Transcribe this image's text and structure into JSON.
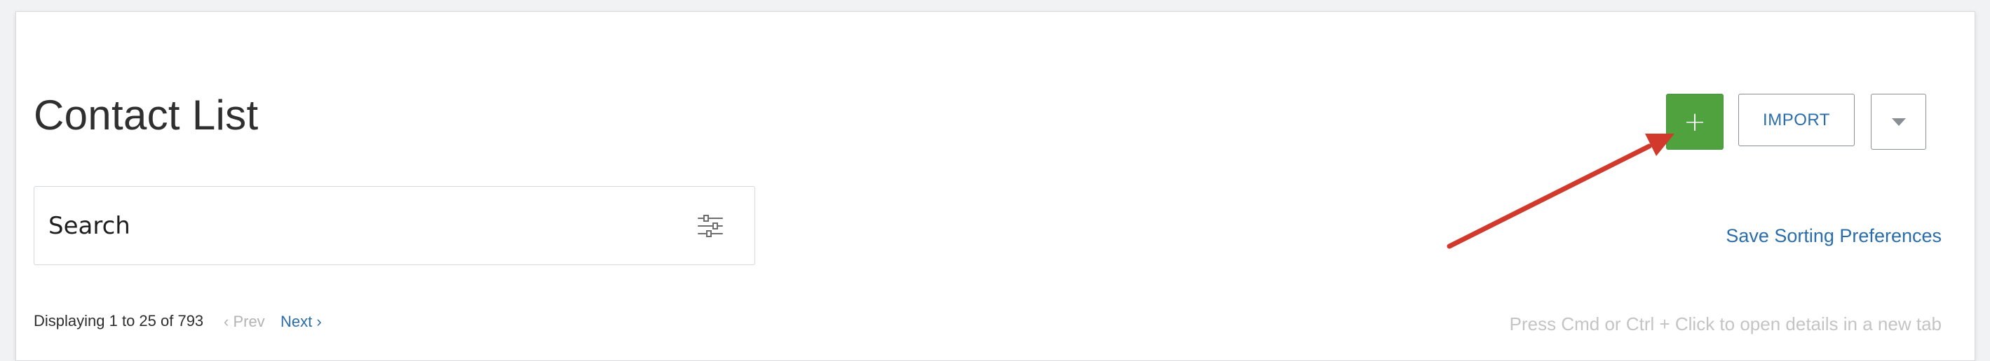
{
  "header": {
    "title": "Contact List",
    "add_label": "+",
    "import_label": "IMPORT",
    "more_icon": "caret-down-icon"
  },
  "search": {
    "placeholder": "Search",
    "filter_icon": "filter-sliders-icon"
  },
  "sorting": {
    "save_label": "Save Sorting Preferences"
  },
  "pagination": {
    "display_text": "Displaying 1 to 25 of 793",
    "prev_label": "‹ Prev",
    "next_label": "Next ›"
  },
  "hint": {
    "text": "Press Cmd or Ctrl + Click to open details in a new tab"
  },
  "colors": {
    "add_button": "#4fa23e",
    "link": "#2a6da8",
    "annotation_arrow": "#d0392b"
  }
}
